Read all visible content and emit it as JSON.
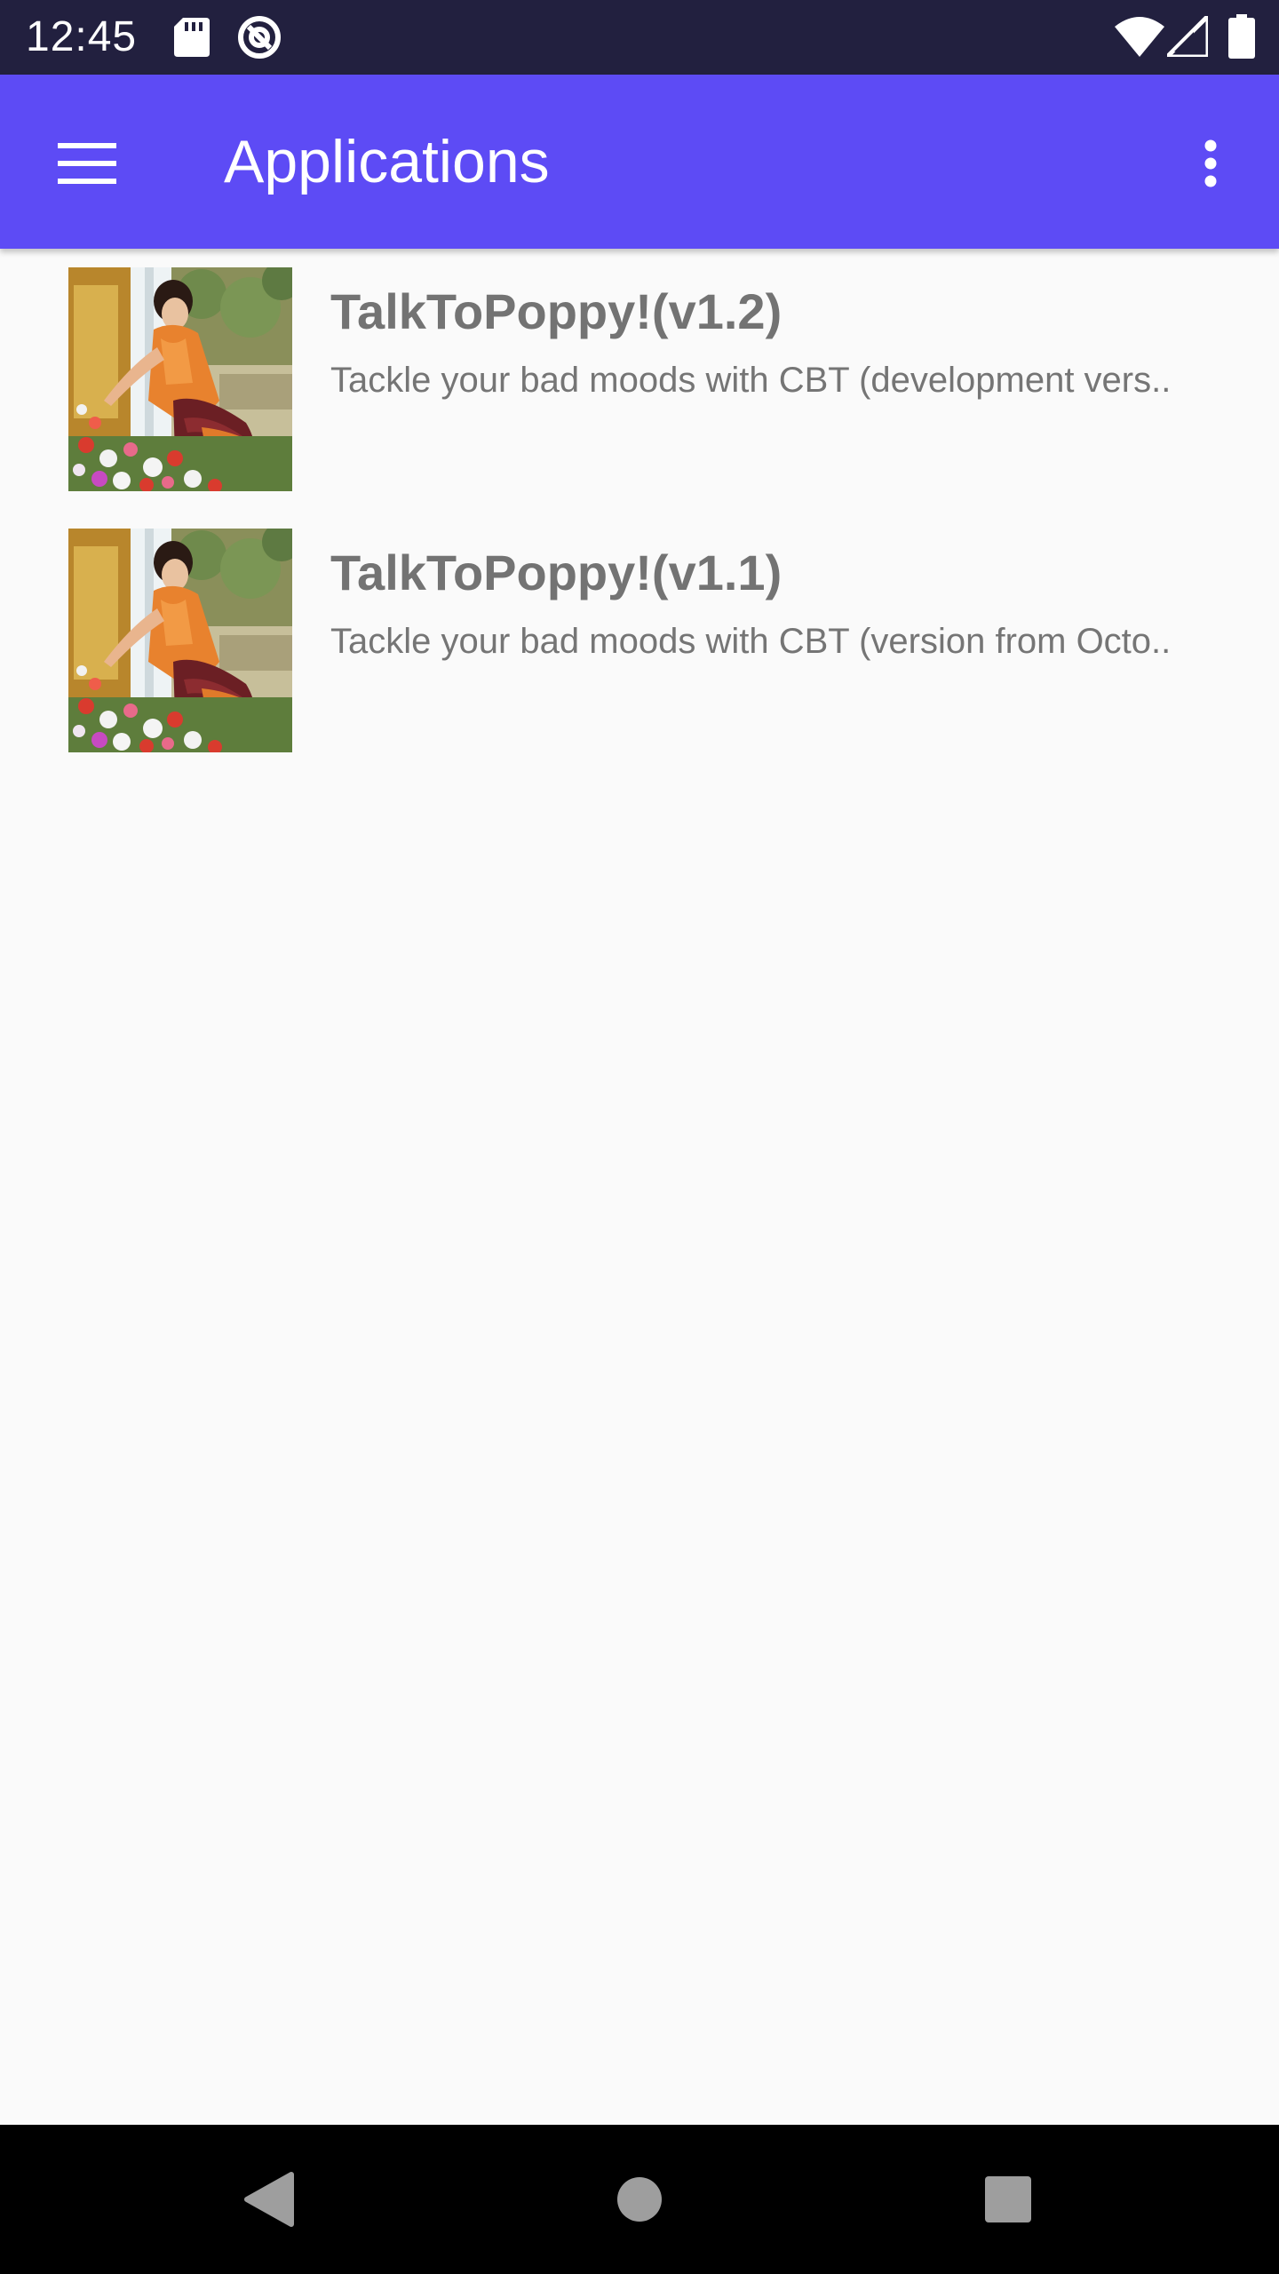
{
  "status_bar": {
    "time": "12:45",
    "icons": [
      "sd-card-icon",
      "at-sign-icon",
      "wifi-icon",
      "cell-signal-icon",
      "battery-icon"
    ]
  },
  "app_bar": {
    "title": "Applications",
    "menu_icon": "hamburger-menu-icon",
    "overflow_icon": "more-vert-icon",
    "background_color": "#5d4bf5"
  },
  "applications": [
    {
      "title": "TalkToPoppy!(v1.2)",
      "subtitle": "Tackle your bad moods with CBT (development vers.."
    },
    {
      "title": "TalkToPoppy!(v1.1)",
      "subtitle": "Tackle your bad moods with CBT (version from Octo.."
    }
  ],
  "navigation_bar": {
    "icons": [
      "back-icon",
      "home-icon",
      "recents-icon"
    ]
  }
}
